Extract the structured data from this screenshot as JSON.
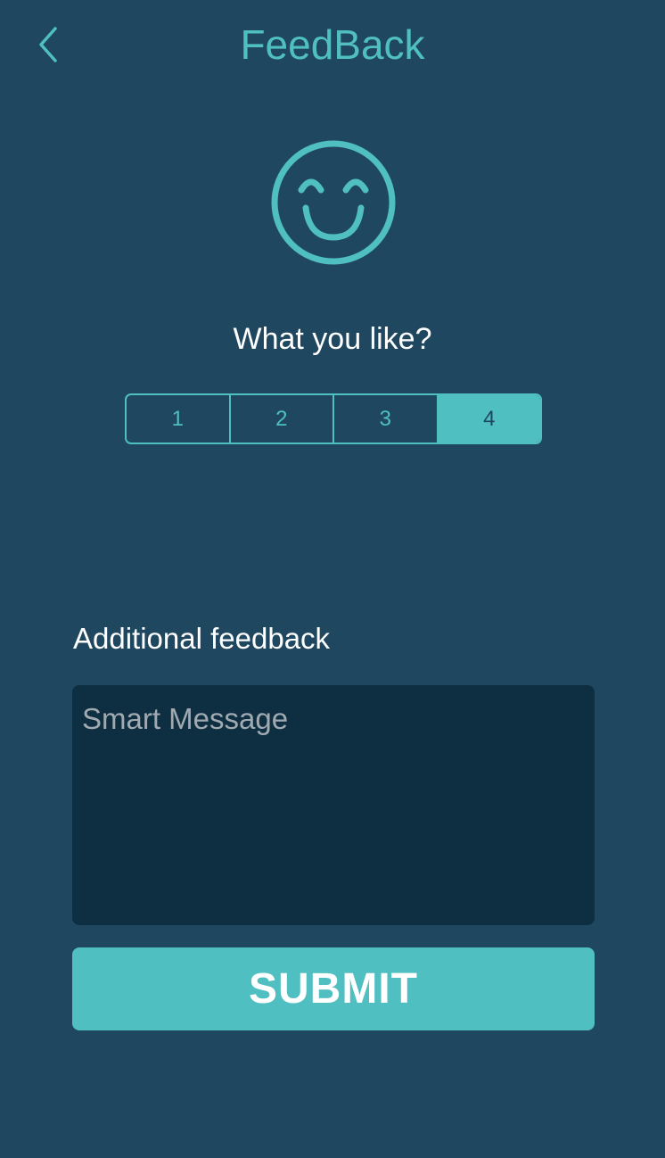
{
  "nav": {
    "title": "FeedBack",
    "back_icon": "chevron-left-icon"
  },
  "hero": {
    "icon": "smiling-face-icon"
  },
  "rating": {
    "question": "What you like?",
    "options": [
      "1",
      "2",
      "3",
      "4"
    ],
    "selected": "4"
  },
  "feedback": {
    "label": "Additional feedback",
    "placeholder": "Smart Message",
    "value": ""
  },
  "submit": {
    "label": "SUBMIT"
  },
  "colors": {
    "background": "#1f4760",
    "accent": "#4fbfc1",
    "input_background": "#0e2e41",
    "text": "#ffffff",
    "placeholder": "#a0aab0"
  }
}
